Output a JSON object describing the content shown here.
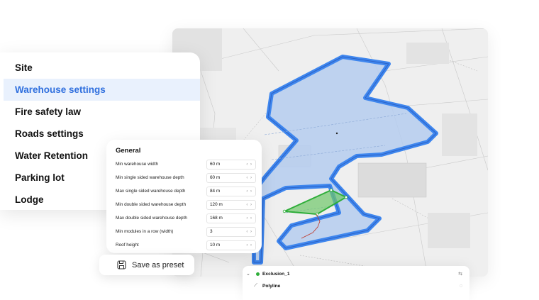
{
  "categories": {
    "items": [
      {
        "label": "Site",
        "active": false
      },
      {
        "label": "Warehouse settings",
        "active": true
      },
      {
        "label": "Fire safety law",
        "active": false
      },
      {
        "label": "Roads settings",
        "active": false
      },
      {
        "label": "Water Retention",
        "active": false
      },
      {
        "label": "Parking lot",
        "active": false
      },
      {
        "label": "Lodge",
        "active": false
      }
    ]
  },
  "settings": {
    "title": "General",
    "rows": [
      {
        "label": "Min warehouse width",
        "value": "60 m"
      },
      {
        "label": "Min single sided warehouse depth",
        "value": "60 m"
      },
      {
        "label": "Max single sided warehouse depth",
        "value": "84 m"
      },
      {
        "label": "Min double sided warehouse depth",
        "value": "120 m"
      },
      {
        "label": "Max double sided warehouse depth",
        "value": "168 m"
      },
      {
        "label": "Min modules in a row (width)",
        "value": "3"
      },
      {
        "label": "Roof height",
        "value": "10 m"
      }
    ]
  },
  "save_preset": {
    "label": "Save as preset"
  },
  "layers": {
    "exclusion_label": "Exclusion_1",
    "polyline_label": "Polyline"
  },
  "colors": {
    "accent_blue": "#2f6fde",
    "site_fill": "#b5cdef",
    "site_stroke": "#3e86ee",
    "exclusion_green": "#2fae3a"
  }
}
